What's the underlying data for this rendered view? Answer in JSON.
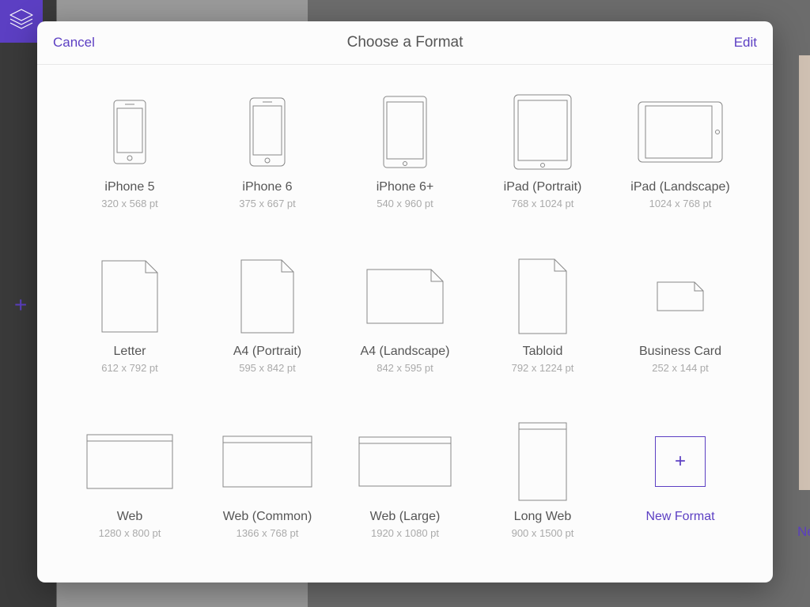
{
  "background": {
    "new_peek": "New"
  },
  "modal": {
    "title": "Choose a Format",
    "cancel": "Cancel",
    "edit": "Edit"
  },
  "formats": [
    {
      "id": "iphone-5",
      "label": "iPhone 5",
      "dims": "320 x 568 pt",
      "icon": "phone-small"
    },
    {
      "id": "iphone-6",
      "label": "iPhone 6",
      "dims": "375 x 667 pt",
      "icon": "phone-med"
    },
    {
      "id": "iphone-6-plus",
      "label": "iPhone 6+",
      "dims": "540 x 960 pt",
      "icon": "tablet-portrait-narrow"
    },
    {
      "id": "ipad-portrait",
      "label": "iPad (Portrait)",
      "dims": "768 x 1024 pt",
      "icon": "tablet-portrait"
    },
    {
      "id": "ipad-landscape",
      "label": "iPad (Landscape)",
      "dims": "1024 x 768 pt",
      "icon": "tablet-landscape"
    },
    {
      "id": "letter",
      "label": "Letter",
      "dims": "612 x 792 pt",
      "icon": "page-tall"
    },
    {
      "id": "a4-portrait",
      "label": "A4 (Portrait)",
      "dims": "595 x 842 pt",
      "icon": "page-tall-2"
    },
    {
      "id": "a4-landscape",
      "label": "A4 (Landscape)",
      "dims": "842 x 595 pt",
      "icon": "page-wide"
    },
    {
      "id": "tabloid",
      "label": "Tabloid",
      "dims": "792 x 1224 pt",
      "icon": "page-xtall"
    },
    {
      "id": "business-card",
      "label": "Business Card",
      "dims": "252 x 144 pt",
      "icon": "page-card"
    },
    {
      "id": "web",
      "label": "Web",
      "dims": "1280 x 800 pt",
      "icon": "browser-wide"
    },
    {
      "id": "web-common",
      "label": "Web (Common)",
      "dims": "1366 x 768 pt",
      "icon": "browser-wide"
    },
    {
      "id": "web-large",
      "label": "Web (Large)",
      "dims": "1920 x 1080 pt",
      "icon": "browser-wider"
    },
    {
      "id": "long-web",
      "label": "Long Web",
      "dims": "900 x 1500 pt",
      "icon": "browser-tall"
    },
    {
      "id": "new-format",
      "label": "New Format",
      "dims": "",
      "icon": "new-format",
      "accent": true
    }
  ]
}
